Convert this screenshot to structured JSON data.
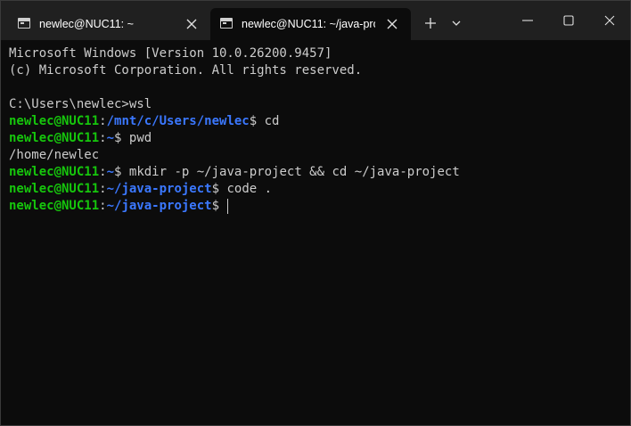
{
  "tabs": [
    {
      "title": "newlec@NUC11: ~",
      "icon": "terminal-icon",
      "active": false
    },
    {
      "title": "newlec@NUC11: ~/java-pro",
      "icon": "terminal-icon",
      "active": true
    }
  ],
  "window_controls": {
    "new_tab_icon": "plus-icon",
    "dropdown_icon": "chevron-down-icon",
    "minimize_icon": "minimize-icon",
    "maximize_icon": "maximize-icon",
    "close_icon": "close-icon"
  },
  "colors": {
    "background": "#0c0c0c",
    "foreground": "#cccccc",
    "user": "#16c60c",
    "path": "#3b78ff",
    "titlebar": "#202020"
  },
  "terminal": {
    "lines": [
      {
        "kind": "text",
        "text": "Microsoft Windows [Version 10.0.26200.9457]"
      },
      {
        "kind": "text",
        "text": "(c) Microsoft Corporation. All rights reserved."
      },
      {
        "kind": "text",
        "text": ""
      },
      {
        "kind": "text",
        "text": "C:\\Users\\newlec>wsl"
      },
      {
        "kind": "prompt",
        "user": "newlec@NUC11",
        "sep": ":",
        "path": "/mnt/c/Users/newlec",
        "symbol": "$",
        "command": " cd"
      },
      {
        "kind": "prompt",
        "user": "newlec@NUC11",
        "sep": ":",
        "path": "~",
        "symbol": "$",
        "command": " pwd"
      },
      {
        "kind": "text",
        "text": "/home/newlec"
      },
      {
        "kind": "prompt",
        "user": "newlec@NUC11",
        "sep": ":",
        "path": "~",
        "symbol": "$",
        "command": " mkdir -p ~/java-project && cd ~/java-project"
      },
      {
        "kind": "prompt",
        "user": "newlec@NUC11",
        "sep": ":",
        "path": "~/java-project",
        "symbol": "$",
        "command": " code ."
      },
      {
        "kind": "prompt",
        "user": "newlec@NUC11",
        "sep": ":",
        "path": "~/java-project",
        "symbol": "$",
        "command": " ",
        "cursor": true
      }
    ]
  }
}
